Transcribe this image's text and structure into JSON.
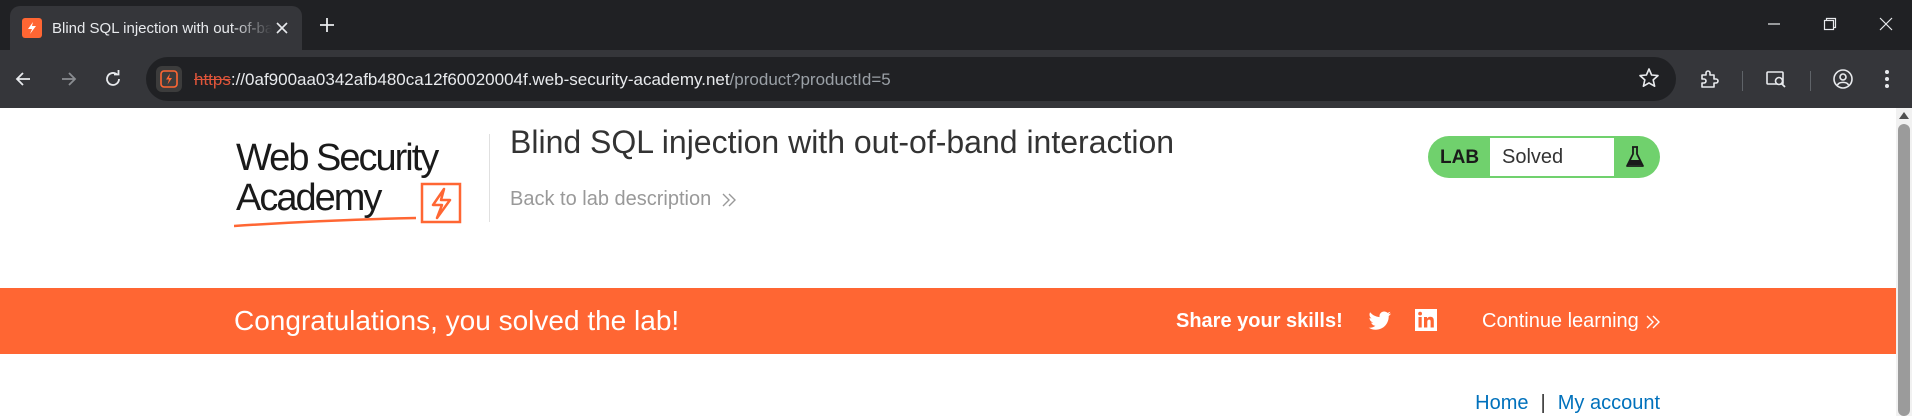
{
  "browser": {
    "tab": {
      "title": "Blind SQL injection with out-of-band interaction"
    },
    "url": {
      "scheme": "https",
      "host": "://0af900aa0342afb480ca12f60020004f.web-security-academy.net",
      "path": "/product?productId=5"
    },
    "icons": [
      "tab-favicon",
      "close-icon",
      "new-tab-icon",
      "minimize-icon",
      "restore-icon",
      "window-close-icon",
      "back-icon",
      "forward-icon",
      "reload-icon",
      "site-info-icon",
      "bookmark-star-icon",
      "extensions-icon",
      "media-control-icon",
      "profile-icon",
      "menu-icon"
    ]
  },
  "header": {
    "logo_lines": [
      "Web Security",
      "Academy"
    ],
    "title": "Blind SQL injection with out-of-band interaction",
    "back_link": "Back to lab description",
    "lab_badge": "LAB",
    "lab_status": "Solved"
  },
  "banner": {
    "message": "Congratulations, you solved the lab!",
    "share": "Share your skills!",
    "continue": "Continue learning"
  },
  "nav": {
    "home": "Home",
    "separator": "|",
    "account": "My account"
  },
  "colors": {
    "brand": "#ff6633",
    "solved": "#70d16d",
    "link": "#0071bc",
    "chrome_dark": "#202124",
    "chrome_toolbar": "#35363a"
  }
}
